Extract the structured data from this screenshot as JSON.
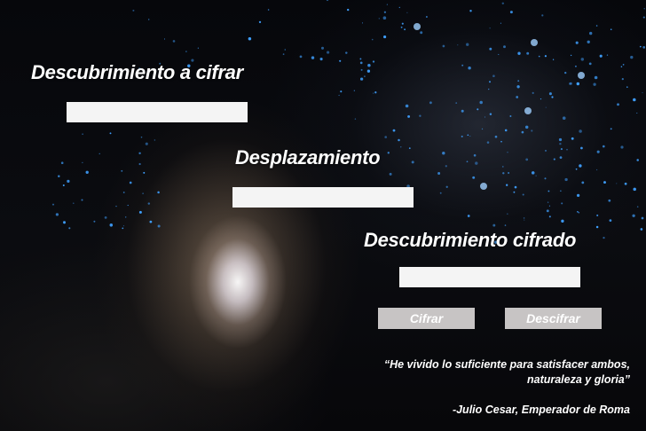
{
  "form": {
    "plaintext_label": "Descubrimiento a cifrar",
    "plaintext_value": "",
    "shift_label": "Desplazamiento",
    "shift_value": "",
    "ciphertext_label": "Descubrimiento cifrado",
    "ciphertext_value": ""
  },
  "buttons": {
    "encrypt_label": "Cifrar",
    "decrypt_label": "Descifrar"
  },
  "quote": {
    "line1": "“He vivido lo suficiente para satisfacer ambos,",
    "line2": "naturaleza y gloria”",
    "author": "-Julio Cesar, Emperador de Roma"
  },
  "colors": {
    "label_text": "#ffffff",
    "field_background": "#f4f4f4",
    "button_background": "#c7c4c4",
    "button_text": "#ffffff",
    "glowworm": "#3fa0ff"
  }
}
